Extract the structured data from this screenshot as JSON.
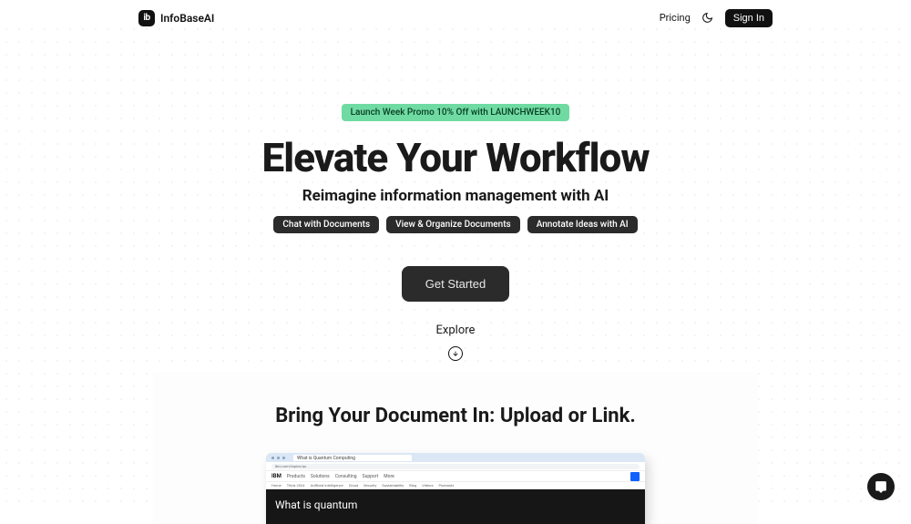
{
  "nav": {
    "brand_mark": "ib",
    "brand_name": "InfoBaseAI",
    "pricing": "Pricing",
    "signin": "Sign In"
  },
  "hero": {
    "promo": "Launch Week Promo 10% Off with LAUNCHWEEK10",
    "headline": "Elevate Your Workflow",
    "subhead": "Reimagine information management with AI",
    "pills": [
      "Chat with Documents",
      "View & Organize Documents",
      "Annotate Ideas with AI"
    ],
    "cta": "Get Started",
    "explore": "Explore"
  },
  "section2": {
    "title": "Bring Your Document In: Upload or Link."
  },
  "mock": {
    "tab_label": "What is Quantum Computing",
    "url": "ibm.com/topics/qu",
    "brand": "IBM",
    "menu": [
      "Products",
      "Solutions",
      "Consulting",
      "Support",
      "More"
    ],
    "subnav": [
      "Home",
      "Think 2024",
      "Artificial Intelligence",
      "Cloud",
      "Security",
      "Sustainability",
      "Blog",
      "Videos",
      "Podcasts"
    ],
    "hero_text": "What is quantum"
  }
}
